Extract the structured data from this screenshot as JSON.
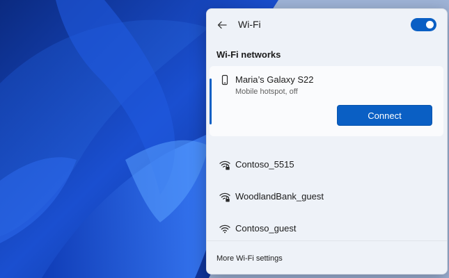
{
  "header": {
    "back_icon": "back-arrow-icon",
    "title": "Wi-Fi",
    "wifi_toggle": {
      "state": "on",
      "color": "#0a5fc4"
    }
  },
  "section_title": "Wi-Fi networks",
  "selected_network": {
    "name": "Maria’s Galaxy S22",
    "status": "Mobile hotspot, off",
    "icon": "phone-icon",
    "connect_label": "Connect"
  },
  "networks": [
    {
      "name": "Contoso_5515",
      "icon": "wifi-secured-icon"
    },
    {
      "name": "WoodlandBank_guest",
      "icon": "wifi-secured-icon"
    },
    {
      "name": "Contoso_guest",
      "icon": "wifi-icon"
    }
  ],
  "footer": {
    "more_settings": "More Wi-Fi settings"
  },
  "colors": {
    "accent": "#0a5fc4",
    "panel_bg": "#eef2f8"
  }
}
